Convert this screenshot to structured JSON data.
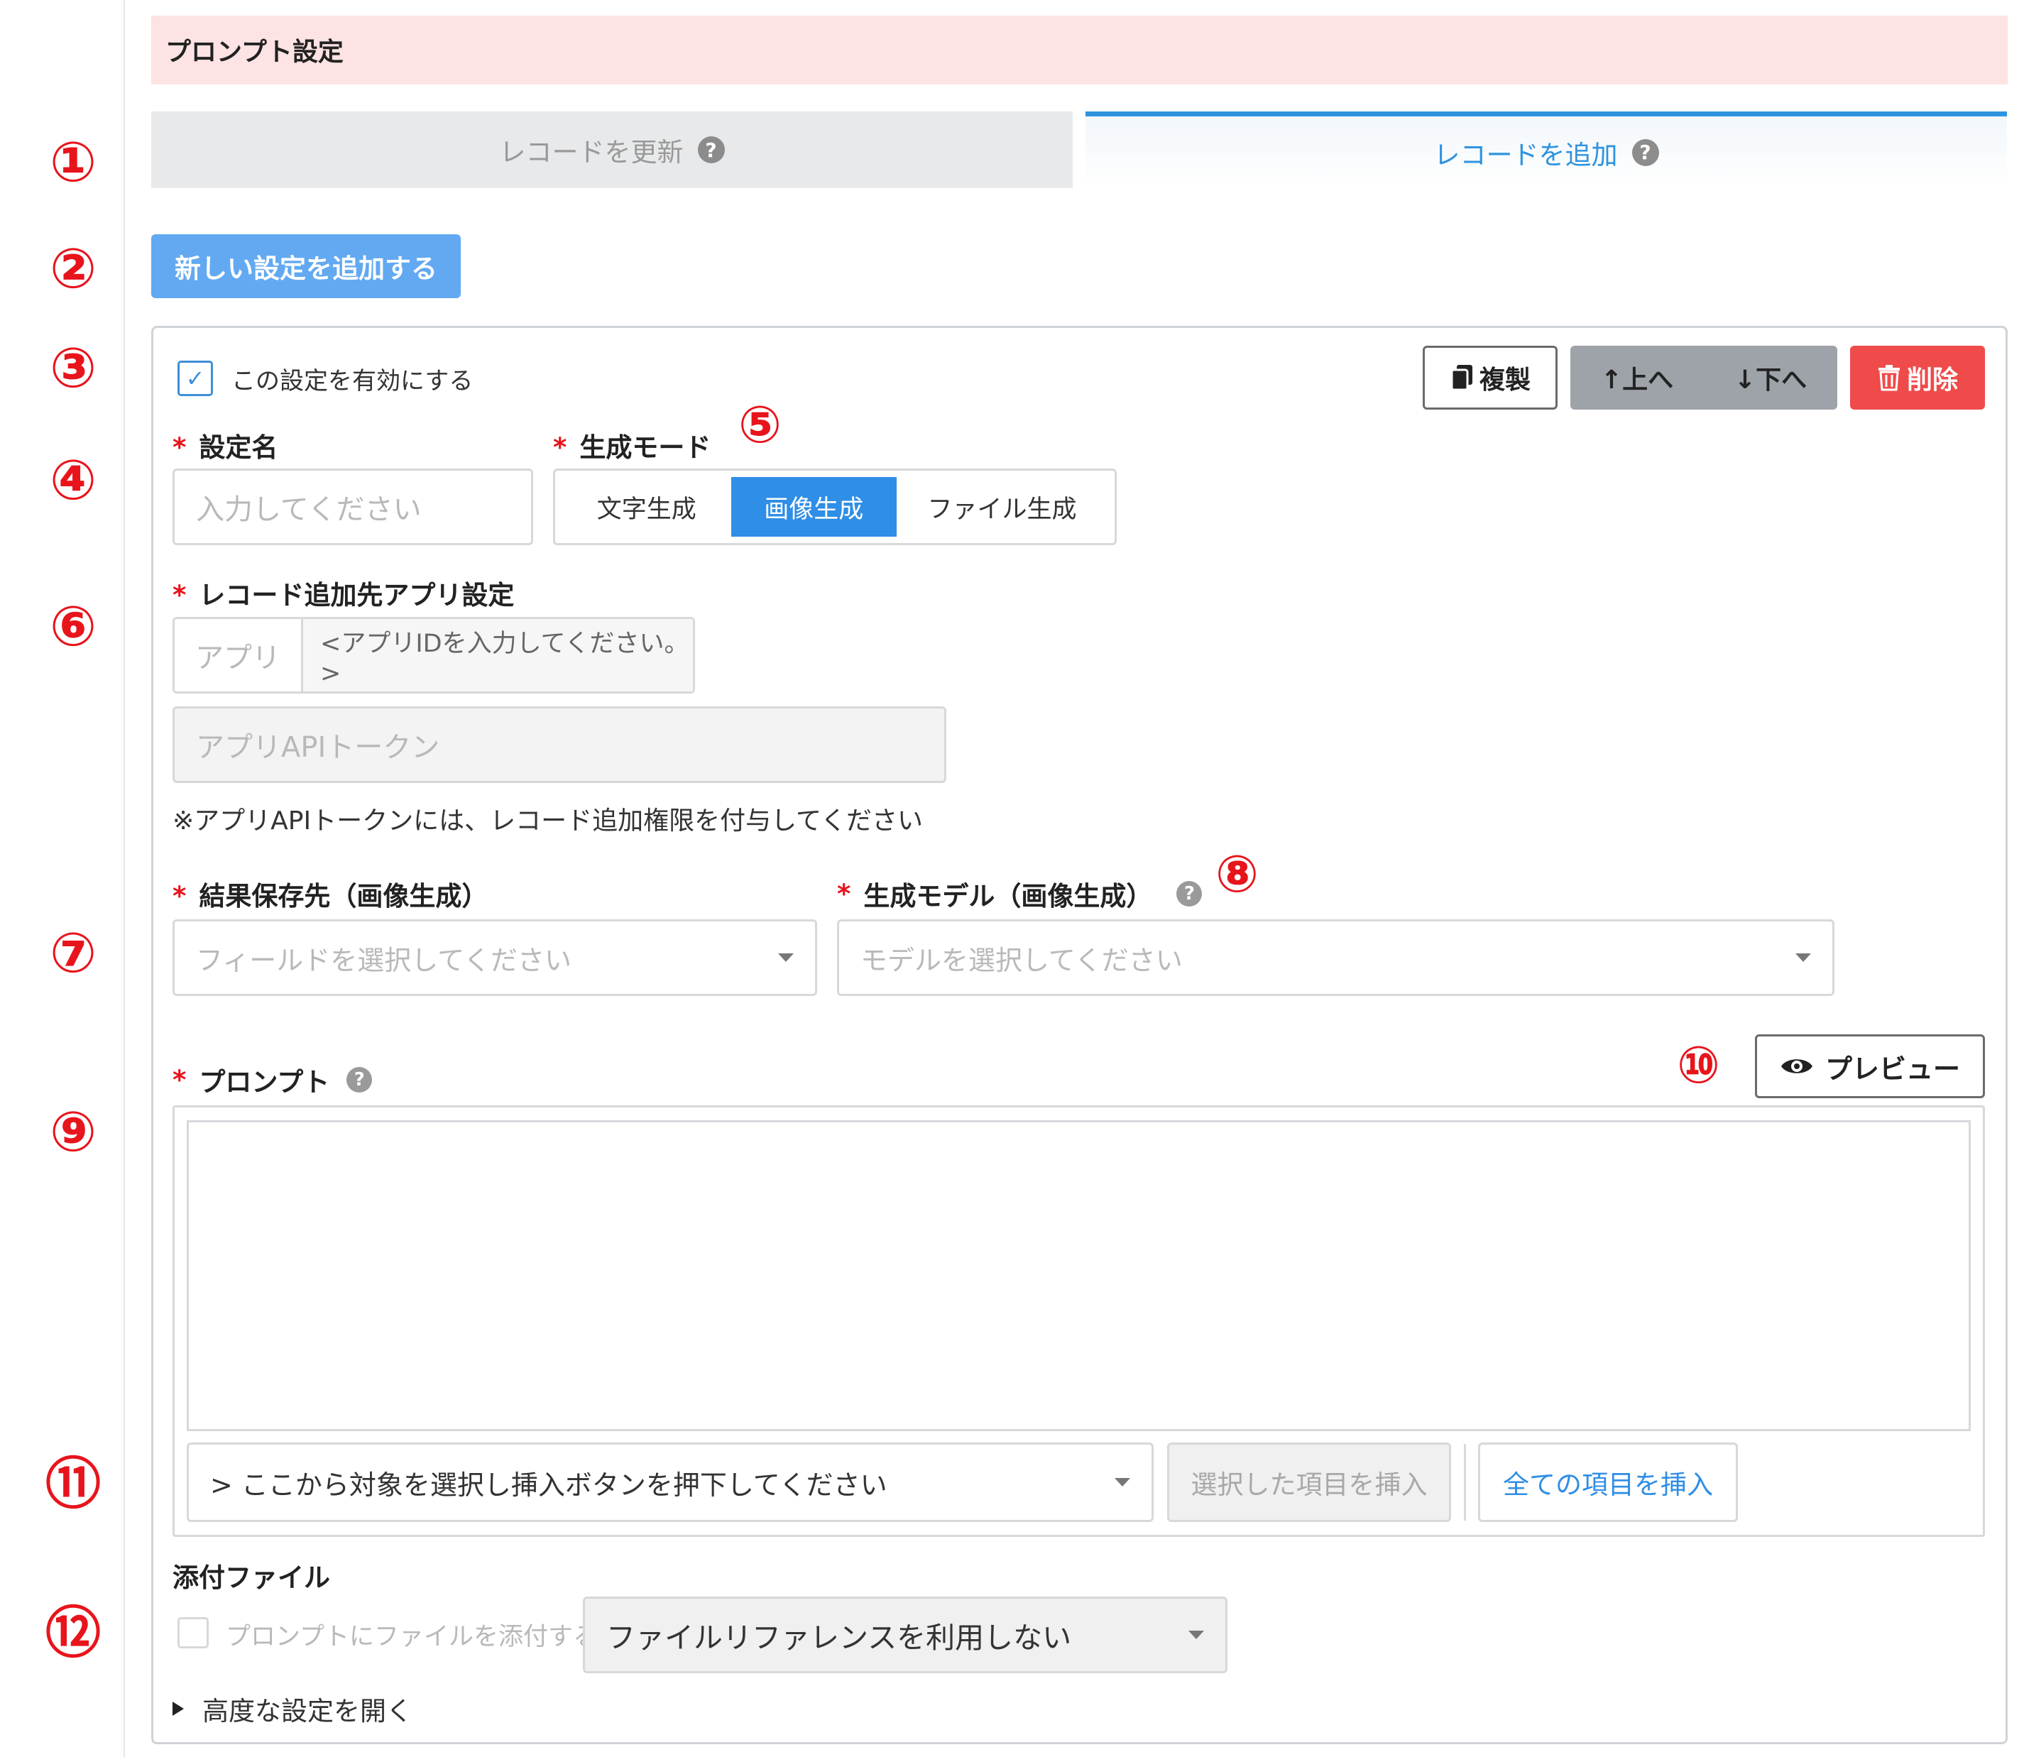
{
  "header": {
    "title": "プロンプト設定"
  },
  "markers": [
    "①",
    "②",
    "③",
    "④",
    "⑤",
    "⑥",
    "⑦",
    "⑧",
    "⑨",
    "⑩",
    "⑪",
    "⑫"
  ],
  "tabs": {
    "update_label": "レコードを更新",
    "add_label": "レコードを追加",
    "active": "add"
  },
  "help_glyph": "?",
  "add_setting_button": "新しい設定を追加する",
  "card": {
    "enable_checkbox": {
      "checked": true,
      "check_glyph": "✓",
      "label": "この設定を有効にする"
    },
    "toolbar": {
      "copy": "複製",
      "up": "↑上へ",
      "down": "↓下へ",
      "delete": "削除"
    },
    "required_mark": "*",
    "setting_name": {
      "label": "設定名",
      "placeholder": "入力してください"
    },
    "generation_mode": {
      "label": "生成モード",
      "options": [
        "文字生成",
        "画像生成",
        "ファイル生成"
      ],
      "selected": "画像生成"
    },
    "app_settings": {
      "label": "レコード追加先アプリ設定",
      "app_addon": "アプリ",
      "app_id_placeholder": "<アプリIDを入力してください。>",
      "token_placeholder": "アプリAPIトークン",
      "note": "※アプリAPIトークンには、レコード追加権限を付与してください"
    },
    "result_field": {
      "label": "結果保存先（画像生成）",
      "placeholder": "フィールドを選択してください"
    },
    "model": {
      "label": "生成モデル（画像生成）",
      "placeholder": "モデルを選択してください"
    },
    "prompt": {
      "label": "プロンプト",
      "value": "",
      "preview_button": "プレビュー",
      "insert_select": "> ここから対象を選択し挿入ボタンを押下してください",
      "insert_selected_button": "選択した項目を挿入",
      "insert_all_button": "全ての項目を挿入"
    },
    "attachment": {
      "title": "添付ファイル",
      "checkbox_label": "プロンプトにファイルを添付する",
      "file_reference_select": "ファイルリファレンスを利用しない"
    },
    "advanced_toggle": "高度な設定を開く"
  },
  "colors": {
    "accent": "#2f8ee6",
    "danger": "#ef4b4b",
    "header_bg": "#fde3e3",
    "marker": "#e8141c"
  }
}
